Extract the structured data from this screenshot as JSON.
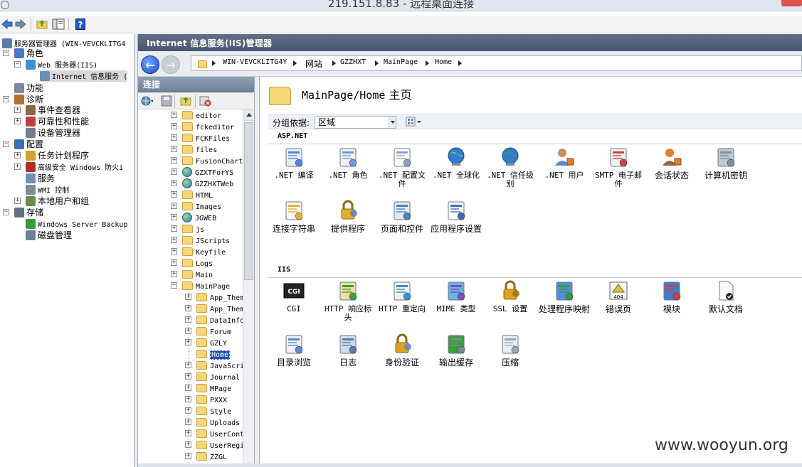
{
  "window": {
    "title": "219.151.8.83 - 远程桌面连接"
  },
  "left_tree": [
    {
      "label": "服务器管理器 (WIN-VEVCKLITG4",
      "indent": 0,
      "expander": "",
      "icon": "server-manager-icon"
    },
    {
      "label": "角色",
      "indent": 1,
      "expander": "−",
      "icon": "roles-icon"
    },
    {
      "label": "Web 服务器(IIS)",
      "indent": 2,
      "expander": "−",
      "icon": "web-server-icon"
    },
    {
      "label": "Internet 信息服务 (",
      "indent": 3,
      "expander": "",
      "icon": "iis-icon",
      "selected": true
    },
    {
      "label": "功能",
      "indent": 1,
      "expander": "",
      "icon": "features-icon"
    },
    {
      "label": "诊断",
      "indent": 1,
      "expander": "−",
      "icon": "diagnostics-icon"
    },
    {
      "label": "事件查看器",
      "indent": 2,
      "expander": "+",
      "icon": "event-viewer-icon"
    },
    {
      "label": "可靠性和性能",
      "indent": 2,
      "expander": "+",
      "icon": "reliability-icon"
    },
    {
      "label": "设备管理器",
      "indent": 2,
      "expander": "",
      "icon": "device-manager-icon"
    },
    {
      "label": "配置",
      "indent": 1,
      "expander": "−",
      "icon": "configuration-icon"
    },
    {
      "label": "任务计划程序",
      "indent": 2,
      "expander": "+",
      "icon": "task-scheduler-icon"
    },
    {
      "label": "高级安全 Windows 防火i",
      "indent": 2,
      "expander": "+",
      "icon": "firewall-icon"
    },
    {
      "label": "服务",
      "indent": 2,
      "expander": "",
      "icon": "services-icon"
    },
    {
      "label": "WMI 控制",
      "indent": 2,
      "expander": "",
      "icon": "wmi-icon"
    },
    {
      "label": "本地用户和组",
      "indent": 2,
      "expander": "+",
      "icon": "local-users-icon"
    },
    {
      "label": "存储",
      "indent": 1,
      "expander": "−",
      "icon": "storage-icon"
    },
    {
      "label": "Windows Server Backup",
      "indent": 2,
      "expander": "",
      "icon": "backup-icon"
    },
    {
      "label": "磁盘管理",
      "indent": 2,
      "expander": "",
      "icon": "disk-management-icon"
    }
  ],
  "iis_header": "Internet 信息服务(IIS)管理器",
  "breadcrumb": [
    "WIN-VEVCKLITG4Y",
    "网站",
    "GZZHXT",
    "MainPage",
    "Home"
  ],
  "connections": {
    "title": "连接",
    "items": [
      {
        "label": "editor",
        "type": "folder",
        "level": 1
      },
      {
        "label": "fckeditor",
        "type": "folder",
        "level": 1
      },
      {
        "label": "FCKFiles",
        "type": "folder",
        "level": 1
      },
      {
        "label": "files",
        "type": "folder",
        "level": 1
      },
      {
        "label": "FusionChart",
        "type": "folder",
        "level": 1
      },
      {
        "label": "GZXTForYS",
        "type": "app",
        "level": 1
      },
      {
        "label": "GZZHXTWeb",
        "type": "app",
        "level": 1
      },
      {
        "label": "HTML",
        "type": "folder",
        "level": 1
      },
      {
        "label": "Images",
        "type": "folder",
        "level": 1
      },
      {
        "label": "JGWEB",
        "type": "app",
        "level": 1
      },
      {
        "label": "js",
        "type": "folder",
        "level": 1
      },
      {
        "label": "JScripts",
        "type": "folder",
        "level": 1
      },
      {
        "label": "Keyfile",
        "type": "folder",
        "level": 1
      },
      {
        "label": "Logs",
        "type": "folder",
        "level": 1
      },
      {
        "label": "Main",
        "type": "folder",
        "level": 1
      },
      {
        "label": "MainPage",
        "type": "folder",
        "level": 1,
        "expanded": true
      },
      {
        "label": "App_Them",
        "type": "folder",
        "level": 2
      },
      {
        "label": "App_Them",
        "type": "folder",
        "level": 2
      },
      {
        "label": "DataInfo",
        "type": "folder",
        "level": 2
      },
      {
        "label": "Forum",
        "type": "folder",
        "level": 2
      },
      {
        "label": "GZLY",
        "type": "folder",
        "level": 2
      },
      {
        "label": "Home",
        "type": "folder",
        "level": 2,
        "selected": true
      },
      {
        "label": "JavaScri",
        "type": "folder",
        "level": 2
      },
      {
        "label": "Journal",
        "type": "folder",
        "level": 2
      },
      {
        "label": "MPage",
        "type": "folder",
        "level": 2
      },
      {
        "label": "PXXX",
        "type": "folder",
        "level": 2
      },
      {
        "label": "Style",
        "type": "folder",
        "level": 2
      },
      {
        "label": "Uploads",
        "type": "folder",
        "level": 2
      },
      {
        "label": "UserCont",
        "type": "folder",
        "level": 2
      },
      {
        "label": "UserRegi",
        "type": "folder",
        "level": 2
      },
      {
        "label": "ZZGL",
        "type": "folder",
        "level": 2
      }
    ]
  },
  "main": {
    "title_path": "MainPage/Home",
    "title_suffix": "主页",
    "group_by_label": "分组依据:",
    "group_by_value": "区域",
    "sections": [
      {
        "name": "ASP.NET",
        "features": [
          {
            "label": ".NET 编译",
            "icon": "dotnet-compile-icon"
          },
          {
            "label": ".NET 角色",
            "icon": "dotnet-roles-icon"
          },
          {
            "label": ".NET 配置文件",
            "icon": "dotnet-profile-icon"
          },
          {
            "label": ".NET 全球化",
            "icon": "dotnet-globalization-icon"
          },
          {
            "label": ".NET 信任级别",
            "icon": "dotnet-trust-icon"
          },
          {
            "label": ".NET 用户",
            "icon": "dotnet-users-icon"
          },
          {
            "label": "SMTP 电子邮件",
            "icon": "smtp-icon"
          },
          {
            "label": "会话状态",
            "icon": "session-state-icon"
          },
          {
            "label": "计算机密钥",
            "icon": "machine-key-icon"
          },
          {
            "label": "连接字符串",
            "icon": "connection-strings-icon"
          },
          {
            "label": "提供程序",
            "icon": "providers-icon"
          },
          {
            "label": "页面和控件",
            "icon": "pages-controls-icon"
          },
          {
            "label": "应用程序设置",
            "icon": "app-settings-icon"
          }
        ]
      },
      {
        "name": "IIS",
        "features": [
          {
            "label": "CGI",
            "icon": "cgi-icon"
          },
          {
            "label": "HTTP 响应标头",
            "icon": "http-headers-icon"
          },
          {
            "label": "HTTP 重定向",
            "icon": "http-redirect-icon"
          },
          {
            "label": "MIME 类型",
            "icon": "mime-types-icon"
          },
          {
            "label": "SSL 设置",
            "icon": "ssl-icon"
          },
          {
            "label": "处理程序映射",
            "icon": "handler-mappings-icon"
          },
          {
            "label": "错误页",
            "icon": "error-pages-icon"
          },
          {
            "label": "模块",
            "icon": "modules-icon"
          },
          {
            "label": "默认文档",
            "icon": "default-document-icon"
          },
          {
            "label": "目录浏览",
            "icon": "directory-browsing-icon"
          },
          {
            "label": "日志",
            "icon": "logging-icon"
          },
          {
            "label": "身份验证",
            "icon": "authentication-icon"
          },
          {
            "label": "输出缓存",
            "icon": "output-caching-icon"
          },
          {
            "label": "压缩",
            "icon": "compression-icon"
          }
        ]
      }
    ]
  },
  "watermark": "www.wooyun.org",
  "colors": {
    "accent_header": "#56667c",
    "selection": "#1d4fb0",
    "folder": "#f7d675"
  }
}
